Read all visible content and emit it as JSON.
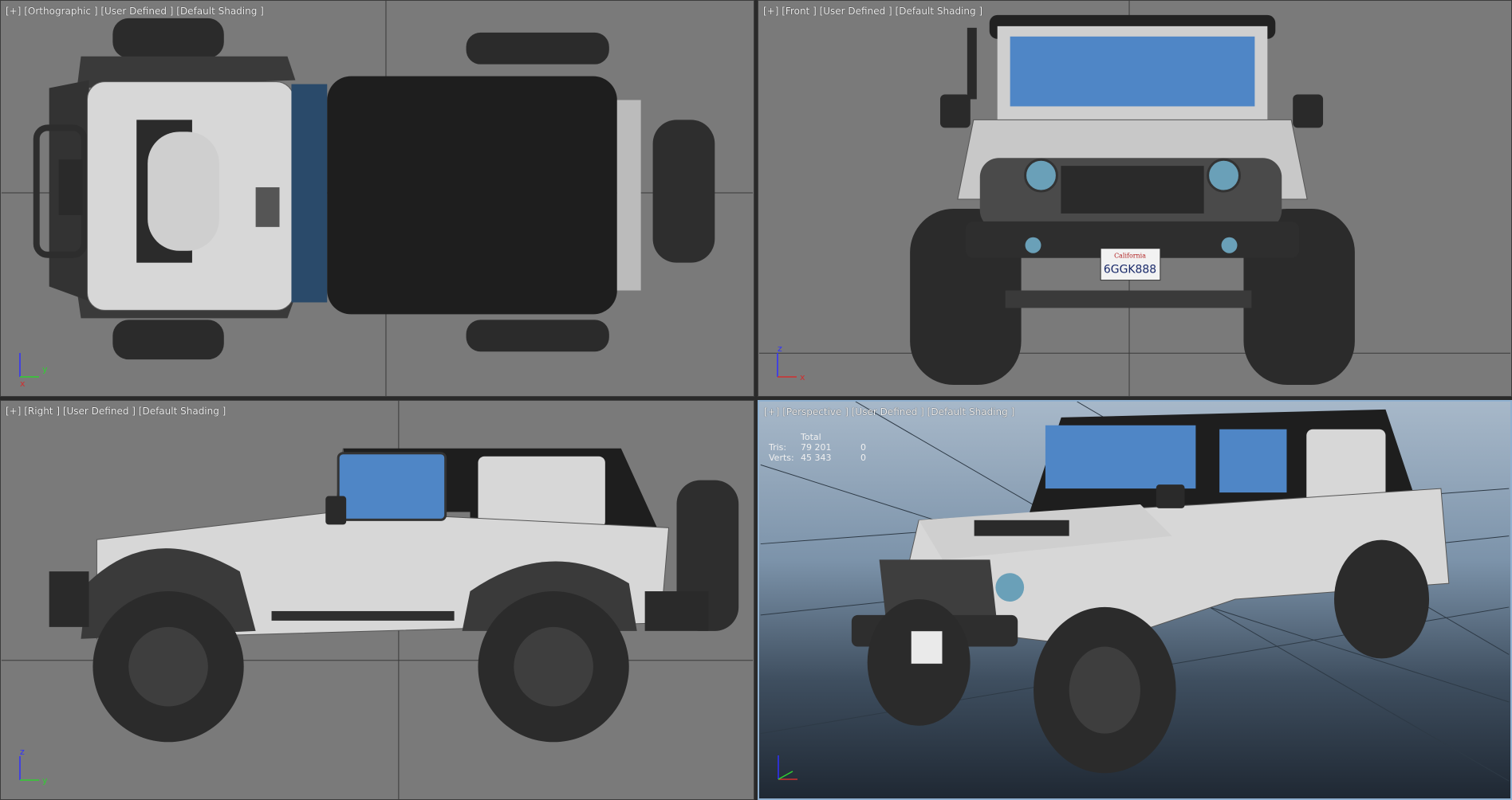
{
  "viewports": {
    "top": {
      "label": "[+] [Orthographic ] [User Defined ] [Default Shading ]"
    },
    "front": {
      "label": "[+] [Front ] [User Defined ] [Default Shading ]"
    },
    "right": {
      "label": "[+] [Right ] [User Defined ] [Default Shading ]"
    },
    "persp": {
      "label": "[+] [Perspective ] [User Defined ] [Default Shading ]",
      "stats": {
        "header": "Total",
        "rows": [
          {
            "name": "Tris:",
            "total": "79 201",
            "sel": "0"
          },
          {
            "name": "Verts:",
            "total": "45 343",
            "sel": "0"
          }
        ]
      }
    }
  },
  "axes": {
    "top": {
      "a": "y",
      "b": "x"
    },
    "front": {
      "a": "z",
      "b": "x"
    },
    "right": {
      "a": "z",
      "b": "y"
    }
  },
  "plate": {
    "state": "California",
    "number": "6GGK888"
  },
  "colors": {
    "viewport_bg": "#7a7a7a",
    "active_border": "#8fb0d0",
    "body": "#d7d7d7",
    "top_soft": "#1e1e1e",
    "glass": "#4f86c6",
    "tire": "#2b2b2b"
  }
}
